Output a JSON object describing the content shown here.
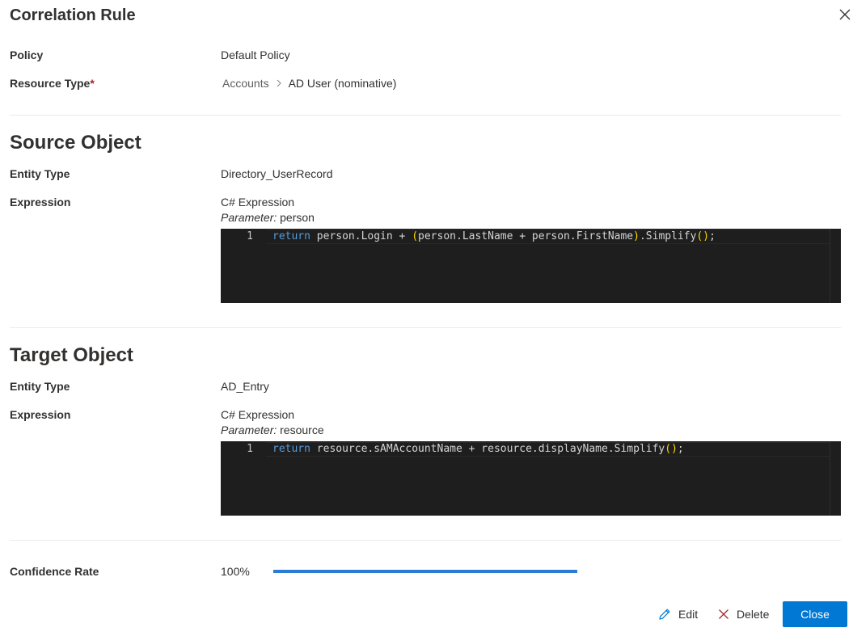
{
  "panel": {
    "title": "Correlation Rule"
  },
  "general": {
    "policy_label": "Policy",
    "policy_value": "Default Policy",
    "resource_type_label": "Resource Type",
    "resource_type_required": "*",
    "resource_type_path": [
      "Accounts",
      "AD User (nominative)"
    ]
  },
  "source": {
    "title": "Source Object",
    "entity_type_label": "Entity Type",
    "entity_type_value": "Directory_UserRecord",
    "expression_label": "Expression",
    "expression_kind": "C# Expression",
    "parameter_label": "Parameter:",
    "parameter_value": "person",
    "code": {
      "line_number": "1",
      "keyword": "return",
      "text_a": " person.Login + ",
      "paren_open": "(",
      "text_b": "person.LastName + person.FirstName",
      "paren_close": ")",
      "text_c": ".Simplify",
      "call": "()",
      "semicolon": ";"
    }
  },
  "target": {
    "title": "Target Object",
    "entity_type_label": "Entity Type",
    "entity_type_value": "AD_Entry",
    "expression_label": "Expression",
    "expression_kind": "C# Expression",
    "parameter_label": "Parameter:",
    "parameter_value": "resource",
    "code": {
      "line_number": "1",
      "keyword": "return",
      "text_a": " resource.sAMAccountName + resource.displayName.Simplify",
      "call": "()",
      "semicolon": ";"
    }
  },
  "confidence": {
    "label": "Confidence Rate",
    "value": "100%",
    "fraction": 1.0
  },
  "footer": {
    "edit_label": "Edit",
    "delete_label": "Delete",
    "close_label": "Close"
  },
  "icons": {
    "close": "close-icon",
    "chevron": "chevron-right-icon",
    "edit": "pencil-icon",
    "delete": "x-icon"
  },
  "colors": {
    "primary": "#0078d4",
    "required": "#a4262c",
    "delete_icon": "#a4262c",
    "edit_icon": "#0078d4",
    "progress": "#2b7cd3",
    "editor_bg": "#1e1e1e",
    "keyword": "#569cd6",
    "bracket": "#ffd700"
  }
}
